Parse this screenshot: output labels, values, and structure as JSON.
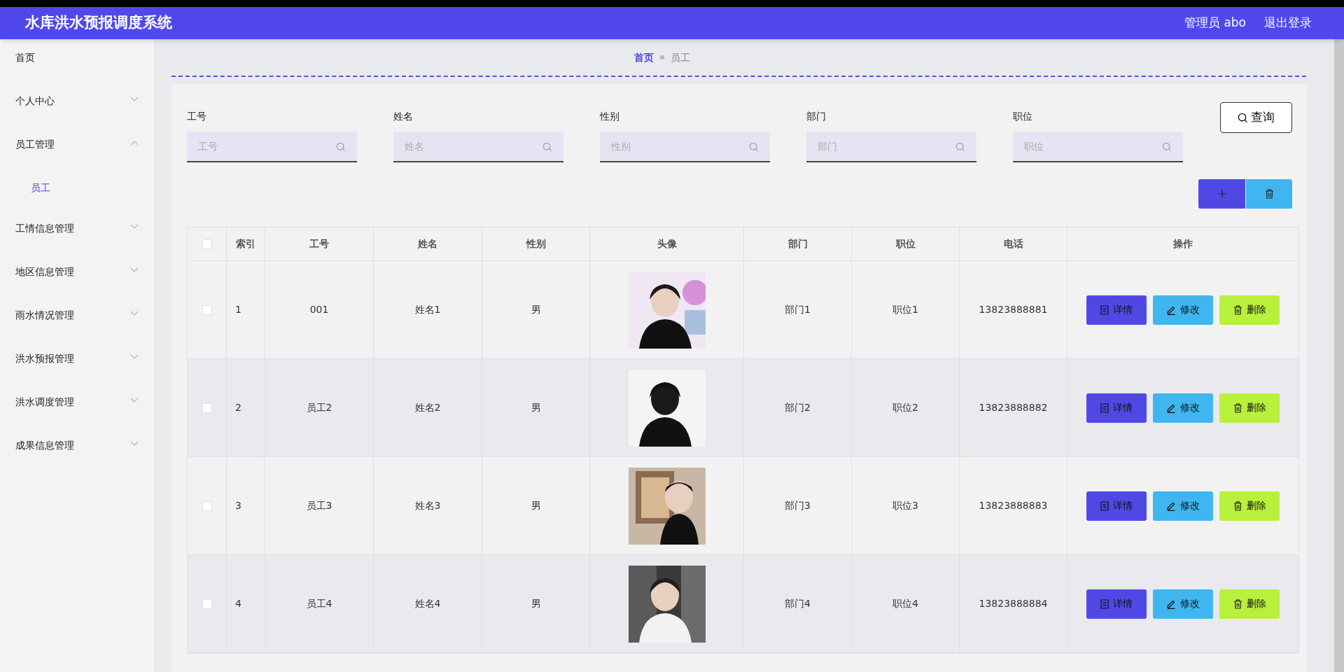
{
  "header": {
    "title": "水库洪水预报调度系统",
    "user": "管理员 abo",
    "logout": "退出登录"
  },
  "sidebar": {
    "items": [
      {
        "label": "首页",
        "expandable": false,
        "selected": false
      },
      {
        "label": "个人中心",
        "expandable": true,
        "expanded": false,
        "selected": false
      },
      {
        "label": "员工管理",
        "expandable": true,
        "expanded": true,
        "selected": false,
        "children": [
          {
            "label": "员工",
            "selected": true
          }
        ]
      },
      {
        "label": "工情信息管理",
        "expandable": true,
        "expanded": false,
        "selected": false
      },
      {
        "label": "地区信息管理",
        "expandable": true,
        "expanded": false,
        "selected": false
      },
      {
        "label": "雨水情况管理",
        "expandable": true,
        "expanded": false,
        "selected": false
      },
      {
        "label": "洪水预报管理",
        "expandable": true,
        "expanded": false,
        "selected": false
      },
      {
        "label": "洪水调度管理",
        "expandable": true,
        "expanded": false,
        "selected": false
      },
      {
        "label": "成果信息管理",
        "expandable": true,
        "expanded": false,
        "selected": false
      }
    ]
  },
  "breadcrumb": [
    {
      "label": "首页",
      "kind": "link"
    },
    {
      "label": "员工",
      "kind": "current"
    }
  ],
  "search": {
    "fields": [
      {
        "label": "工号",
        "placeholder": "工号"
      },
      {
        "label": "姓名",
        "placeholder": "姓名"
      },
      {
        "label": "性别",
        "placeholder": "性别"
      },
      {
        "label": "部门",
        "placeholder": "部门"
      },
      {
        "label": "职位",
        "placeholder": "职位"
      }
    ],
    "button": "查询"
  },
  "table": {
    "header_checked": false,
    "columns": [
      "索引",
      "工号",
      "姓名",
      "性别",
      "头像",
      "部门",
      "职位",
      "电话",
      "操作"
    ],
    "rows": [
      {
        "checked": false,
        "index": "1",
        "id": "001",
        "name": "姓名1",
        "gender": "男",
        "avatar": {
          "kind": "picture"
        },
        "dept": "部门1",
        "position": "职位1",
        "phone": "13823888881",
        "actions": [
          {
            "label": "详情",
            "kind": "detail"
          },
          {
            "label": "修改",
            "kind": "edit"
          },
          {
            "label": "删除",
            "kind": "delete"
          }
        ]
      },
      {
        "checked": false,
        "index": "2",
        "id": "员工2",
        "name": "姓名2",
        "gender": "男",
        "avatar": {
          "kind": "picture"
        },
        "dept": "部门2",
        "position": "职位2",
        "phone": "13823888882",
        "actions": [
          {
            "label": "详情",
            "kind": "detail"
          },
          {
            "label": "修改",
            "kind": "edit"
          },
          {
            "label": "删除",
            "kind": "delete"
          }
        ]
      },
      {
        "checked": false,
        "index": "3",
        "id": "员工3",
        "name": "姓名3",
        "gender": "男",
        "avatar": {
          "kind": "picture"
        },
        "dept": "部门3",
        "position": "职位3",
        "phone": "13823888883",
        "actions": [
          {
            "label": "详情",
            "kind": "detail"
          },
          {
            "label": "修改",
            "kind": "edit"
          },
          {
            "label": "删除",
            "kind": "delete"
          }
        ]
      },
      {
        "checked": false,
        "index": "4",
        "id": "员工4",
        "name": "姓名4",
        "gender": "男",
        "avatar": {
          "kind": "picture"
        },
        "dept": "部门4",
        "position": "职位4",
        "phone": "13823888884",
        "actions": [
          {
            "label": "详情",
            "kind": "detail"
          },
          {
            "label": "修改",
            "kind": "edit"
          },
          {
            "label": "删除",
            "kind": "delete"
          }
        ]
      }
    ]
  }
}
